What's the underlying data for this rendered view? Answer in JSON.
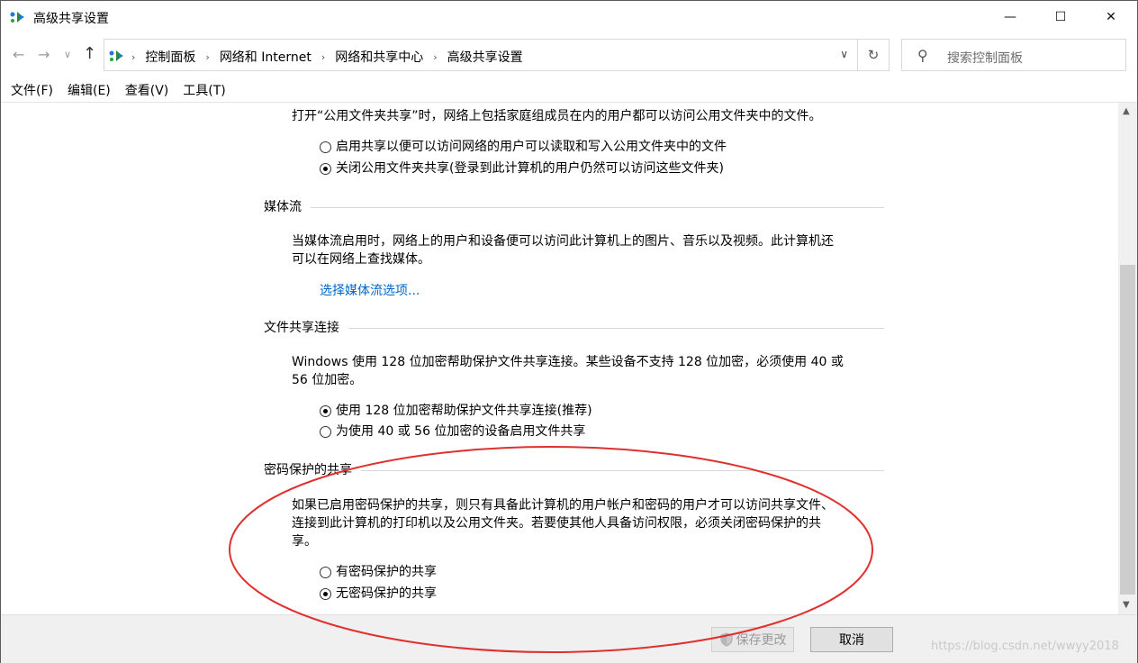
{
  "window": {
    "title": "高级共享设置",
    "min_glyph": "—",
    "max_glyph": "☐",
    "close_glyph": "✕"
  },
  "nav": {
    "back": "←",
    "forward": "→",
    "recent": "∨",
    "up": "↑"
  },
  "address": {
    "sep": "›",
    "crumbs": [
      "控制面板",
      "网络和 Internet",
      "网络和共享中心",
      "高级共享设置"
    ],
    "dropdown": "∨",
    "refresh": "↻"
  },
  "search": {
    "icon": "⚲",
    "placeholder": "搜索控制面板"
  },
  "menu": [
    "文件(F)",
    "编辑(E)",
    "查看(V)",
    "工具(T)"
  ],
  "public_folder": {
    "desc": "打开“公用文件夹共享”时，网络上包括家庭组成员在内的用户都可以访问公用文件夹中的文件。",
    "opt1": "启用共享以便可以访问网络的用户可以读取和写入公用文件夹中的文件",
    "opt2": "关闭公用文件夹共享(登录到此计算机的用户仍然可以访问这些文件夹)"
  },
  "media": {
    "heading": "媒体流",
    "line1": "当媒体流启用时，网络上的用户和设备便可以访问此计算机上的图片、音乐以及视频。此计算机还",
    "line2": "可以在网络上查找媒体。",
    "link": "选择媒体流选项..."
  },
  "file_sharing": {
    "heading": "文件共享连接",
    "line1": "Windows 使用 128 位加密帮助保护文件共享连接。某些设备不支持 128 位加密，必须使用 40 或",
    "line2": "56 位加密。",
    "opt1": "使用 128 位加密帮助保护文件共享连接(推荐)",
    "opt2": "为使用 40 或 56 位加密的设备启用文件共享"
  },
  "password": {
    "heading": "密码保护的共享",
    "line1": "如果已启用密码保护的共享，则只有具备此计算机的用户帐户和密码的用户才可以访问共享文件、",
    "line2": "连接到此计算机的打印机以及公用文件夹。若要使其他人具备访问权限，必须关闭密码保护的共",
    "line3": "享。",
    "opt1": "有密码保护的共享",
    "opt2": "无密码保护的共享"
  },
  "footer": {
    "save": "保存更改",
    "cancel": "取消",
    "watermark": "https://blog.csdn.net/wwyy2018"
  },
  "scroll": {
    "up": "▲",
    "down": "▼"
  },
  "colors": {
    "link": "#0066cc",
    "annotation": "#e03030"
  }
}
